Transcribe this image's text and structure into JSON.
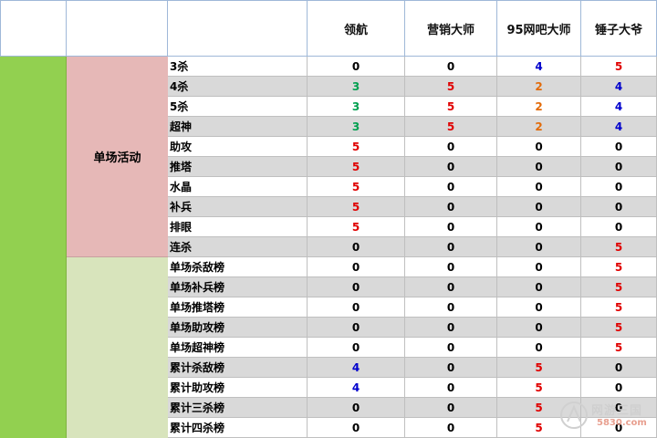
{
  "header": {
    "columns": [
      "领航",
      "营销大师",
      "95网吧大师",
      "锤子大爷"
    ]
  },
  "group_label": "单场活动",
  "rows": [
    {
      "label": "3杀",
      "values": [
        "0",
        "0",
        "4",
        "5"
      ]
    },
    {
      "label": "4杀",
      "values": [
        "3",
        "5",
        "2",
        "4"
      ]
    },
    {
      "label": "5杀",
      "values": [
        "3",
        "5",
        "2",
        "4"
      ]
    },
    {
      "label": "超神",
      "values": [
        "3",
        "5",
        "2",
        "4"
      ]
    },
    {
      "label": "助攻",
      "values": [
        "5",
        "0",
        "0",
        "0"
      ]
    },
    {
      "label": "推塔",
      "values": [
        "5",
        "0",
        "0",
        "0"
      ]
    },
    {
      "label": "水晶",
      "values": [
        "5",
        "0",
        "0",
        "0"
      ]
    },
    {
      "label": "补兵",
      "values": [
        "5",
        "0",
        "0",
        "0"
      ]
    },
    {
      "label": "排眼",
      "values": [
        "5",
        "0",
        "0",
        "0"
      ]
    },
    {
      "label": "连杀",
      "values": [
        "0",
        "0",
        "0",
        "5"
      ]
    },
    {
      "label": "单场杀敌榜",
      "values": [
        "0",
        "0",
        "0",
        "5"
      ]
    },
    {
      "label": "单场补兵榜",
      "values": [
        "0",
        "0",
        "0",
        "5"
      ]
    },
    {
      "label": "单场推塔榜",
      "values": [
        "0",
        "0",
        "0",
        "5"
      ]
    },
    {
      "label": "单场助攻榜",
      "values": [
        "0",
        "0",
        "0",
        "5"
      ]
    },
    {
      "label": "单场超神榜",
      "values": [
        "0",
        "0",
        "0",
        "5"
      ]
    },
    {
      "label": "累计杀敌榜",
      "values": [
        "4",
        "0",
        "5",
        "0"
      ]
    },
    {
      "label": "累计助攻榜",
      "values": [
        "4",
        "0",
        "5",
        "0"
      ]
    },
    {
      "label": "累计三杀榜",
      "values": [
        "0",
        "0",
        "5",
        "0"
      ]
    },
    {
      "label": "累计四杀榜",
      "values": [
        "0",
        "0",
        "5",
        "0"
      ]
    }
  ],
  "value_colors": {
    "0": "#000000",
    "2": "#e26b0a",
    "3": "#00a050",
    "4": "#0000cc",
    "5": "#e00000"
  },
  "watermark": {
    "text": "网游三国",
    "sub": "5830.com"
  }
}
